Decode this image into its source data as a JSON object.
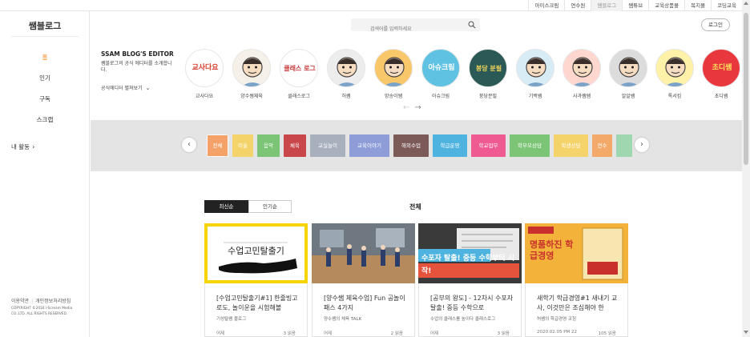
{
  "top_links": [
    {
      "label": "아이스크림",
      "active": false
    },
    {
      "label": "연수원",
      "active": false
    },
    {
      "label": "쌤블로그",
      "active": true
    },
    {
      "label": "쌤튜브",
      "active": false
    },
    {
      "label": "교육상품몰",
      "active": false
    },
    {
      "label": "복지몰",
      "active": false
    },
    {
      "label": "코딩교육",
      "active": false
    }
  ],
  "sidebar": {
    "logo": "쌤블로그",
    "nav": [
      {
        "label": "홈",
        "active": true
      },
      {
        "label": "인기",
        "active": false
      },
      {
        "label": "구독",
        "active": false
      },
      {
        "label": "스크랩",
        "active": false
      }
    ],
    "my_activity": "내 활동",
    "footer_links": [
      "이용약관",
      "개인정보처리방침"
    ],
    "copyright": "COPYRIGHT ©2016 i-Scream Media CO.,LTD. ALL RIGHTS RESERVED."
  },
  "search": {
    "placeholder": "검색어를 입력하세요"
  },
  "login_label": "로그인",
  "editor": {
    "title": "SSAM BLOG'S EDITOR",
    "description": "쌤블로그의 공식 에디터를 소개합니다.",
    "more_label": "공식에디터 펼쳐보기",
    "avatars": [
      {
        "name": "교사다요",
        "bg": "#ffffff",
        "text": "교사다요",
        "text_color": "#d93b2c"
      },
      {
        "name": "양수쌤체육",
        "bg": "#f5f1e8",
        "text": "",
        "text_color": "#333333"
      },
      {
        "name": "클래스로그",
        "bg": "#ffffff",
        "text": "클래스 로그",
        "text_color": "#c93a3a"
      },
      {
        "name": "허쌤",
        "bg": "#ededed",
        "text": "",
        "text_color": "#333333"
      },
      {
        "name": "망송이쌤",
        "bg": "#f7c76a",
        "text": "",
        "text_color": "#333333"
      },
      {
        "name": "아슈크림",
        "bg": "#5fc2e3",
        "text": "아슈크림",
        "text_color": "#ffffff"
      },
      {
        "name": "붕당분필",
        "bg": "#2b5a56",
        "text": "붕당 분필",
        "text_color": "#f2d45c"
      },
      {
        "name": "기백쌤",
        "bg": "#d7ecf4",
        "text": "",
        "text_color": "#333333"
      },
      {
        "name": "사과쌤쌤",
        "bg": "#ffd7cf",
        "text": "",
        "text_color": "#333333"
      },
      {
        "name": "알알쌤",
        "bg": "#dcdcdc",
        "text": "",
        "text_color": "#333333"
      },
      {
        "name": "톡서킴",
        "bg": "#fff1a8",
        "text": "",
        "text_color": "#333333"
      },
      {
        "name": "초디쌤",
        "bg": "#e8383d",
        "text": "초디쌤",
        "text_color": "#ffe05c"
      }
    ]
  },
  "categories": [
    {
      "label": "전체",
      "color": "#f5a26a",
      "outline": true
    },
    {
      "label": "미술",
      "color": "#f4d36a",
      "outline": false
    },
    {
      "label": "음악",
      "color": "#7cc576",
      "outline": false
    },
    {
      "label": "체육",
      "color": "#c9474a",
      "outline": false
    },
    {
      "label": "교실놀이",
      "color": "#a8b0bd",
      "outline": false
    },
    {
      "label": "교육이야기",
      "color": "#8e9cd8",
      "outline": false
    },
    {
      "label": "해외수업",
      "color": "#7b5a58",
      "outline": false
    },
    {
      "label": "학급운영",
      "color": "#4fb3e0",
      "outline": false
    },
    {
      "label": "학교업무",
      "color": "#ef5a92",
      "outline": false
    },
    {
      "label": "학부모상담",
      "color": "#7cc576",
      "outline": false
    },
    {
      "label": "학생상담",
      "color": "#f4d36a",
      "outline": false
    },
    {
      "label": "연수",
      "color": "#f2a96a",
      "outline": false
    },
    {
      "label": "",
      "color": "#9fd8b0",
      "outline": false
    }
  ],
  "tabs": [
    {
      "label": "최신순",
      "active": true
    },
    {
      "label": "인기순",
      "active": false
    }
  ],
  "section_title": "전체",
  "cards": [
    {
      "title": "[수업고민탈출기#1] 한줄빙고로도, 놀이운을 시험해볼",
      "author": "기성탈쌤 블로그",
      "date": "어제",
      "reads": "3 읽음",
      "thumb_bg": "#ffffff",
      "thumb_border": "#f5d400",
      "thumb_text": "수업고민탈출기",
      "thumb_text_color": "#222222"
    },
    {
      "title": "[양수쌤 체육수업] Fun 공놀이 패스 4가지",
      "author": "양수쌤의 체육 TALK",
      "date": "어제",
      "reads": "2 읽음",
      "thumb_bg": "#8a8f96",
      "thumb_border": "",
      "thumb_text": "",
      "thumb_text_color": "#ffffff"
    },
    {
      "title": "[공부의 왕도] - 12차시 수포자 탈출! 중등 수학으로",
      "author": "수업의 클래스를 높이다 클래스로그",
      "date": "어제",
      "reads": "3 읽음",
      "thumb_bg": "#3c3c3c",
      "thumb_border": "",
      "thumb_text": "수포자 탈출! 중등 수학부터 시작!",
      "thumb_text_color": "#ffffff"
    },
    {
      "title": "새학기 학급경영#1 새내기 교사, 이것만은 조심해야 한",
      "author": "허쌤의 학급경영 코칭",
      "date": "2020.02.05 PM 22",
      "reads": "105 읽음",
      "thumb_bg": "#f3b23a",
      "thumb_border": "",
      "thumb_text": "명품하진 학급경영",
      "thumb_text_color": "#c9302c"
    }
  ]
}
